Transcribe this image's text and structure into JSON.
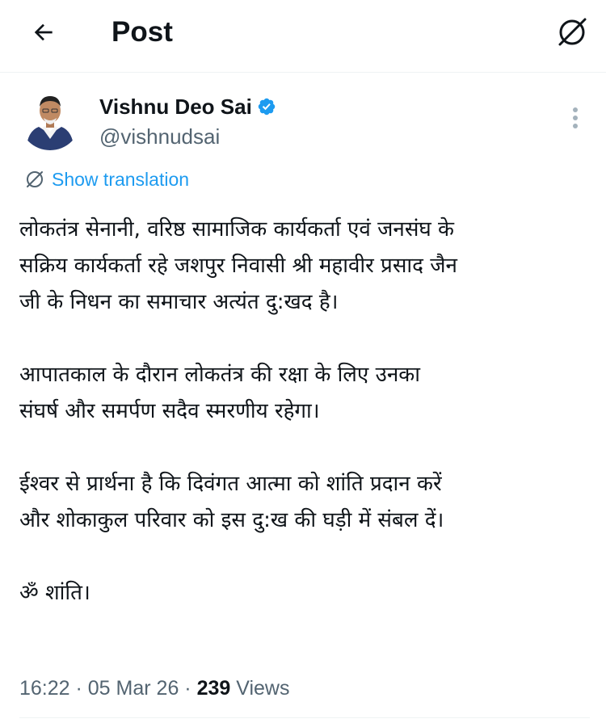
{
  "header": {
    "title": "Post",
    "back_icon": "arrow-left-icon",
    "grok_icon": "grok-icon"
  },
  "author": {
    "name": "Vishnu Deo Sai",
    "handle": "@vishnudsai",
    "verified": true,
    "verified_color": "#1d9bf0"
  },
  "translation": {
    "label": "Show translation",
    "icon": "globe-icon"
  },
  "tweet": {
    "paragraphs": [
      {
        "lines": [
          "लोकतंत्र सेनानी, वरिष्ठ सामाजिक कार्यकर्ता एवं जनसंघ के",
          "सक्रिय कार्यकर्ता रहे जशपुर निवासी श्री महावीर प्रसाद जैन",
          "जी के निधन का समाचार अत्यंत दु:खद है।"
        ]
      },
      {
        "lines": [
          "आपातकाल के दौरान लोकतंत्र की रक्षा के लिए उनका",
          "संघर्ष और समर्पण सदैव स्मरणीय रहेगा।"
        ]
      },
      {
        "lines": [
          "ईश्वर से प्रार्थना है कि दिवंगत आत्मा को शांति प्रदान करें",
          "और शोकाकुल परिवार को इस दु:ख की घड़ी में संबल दें।"
        ]
      },
      {
        "lines": [
          "ॐ शांति।"
        ]
      }
    ]
  },
  "meta": {
    "time": "16:22",
    "separator": " · ",
    "date": "05 Mar 26",
    "views_count": "239",
    "views_label": " Views"
  },
  "colors": {
    "accent": "#1d9bf0",
    "secondary_text": "#536471",
    "primary_text": "#0f1419",
    "divider": "#eff3f4"
  }
}
